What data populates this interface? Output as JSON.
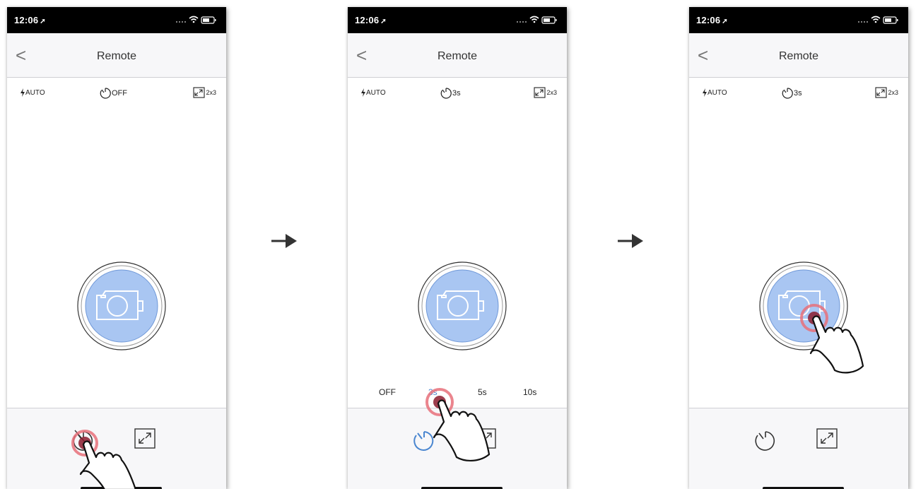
{
  "screens": [
    {
      "status_time": "12:06",
      "nav_title": "Remote",
      "flash_label": "AUTO",
      "timer_label": "OFF",
      "size_label": "2x3"
    },
    {
      "status_time": "12:06",
      "nav_title": "Remote",
      "flash_label": "AUTO",
      "timer_label": "3s",
      "size_label": "2x3",
      "timer_options": [
        "OFF",
        "3s",
        "5s",
        "10s"
      ],
      "selected_timer": "3s"
    },
    {
      "status_time": "12:06",
      "nav_title": "Remote",
      "flash_label": "AUTO",
      "timer_label": "3s",
      "size_label": "2x3"
    }
  ],
  "icons": {
    "back": "chevron-left-icon",
    "flash": "lightning-icon",
    "timer": "timer-icon",
    "size": "expand-icon",
    "shutter": "camera-icon",
    "tap_hint": "hand-pointer-icon",
    "step_arrow": "arrow-right-icon"
  },
  "colors": {
    "shutter_fill": "#a9c6f2",
    "shutter_stroke": "#6f98d8",
    "tap_ring": "#e8707a",
    "timer_active": "#4a86d0"
  }
}
